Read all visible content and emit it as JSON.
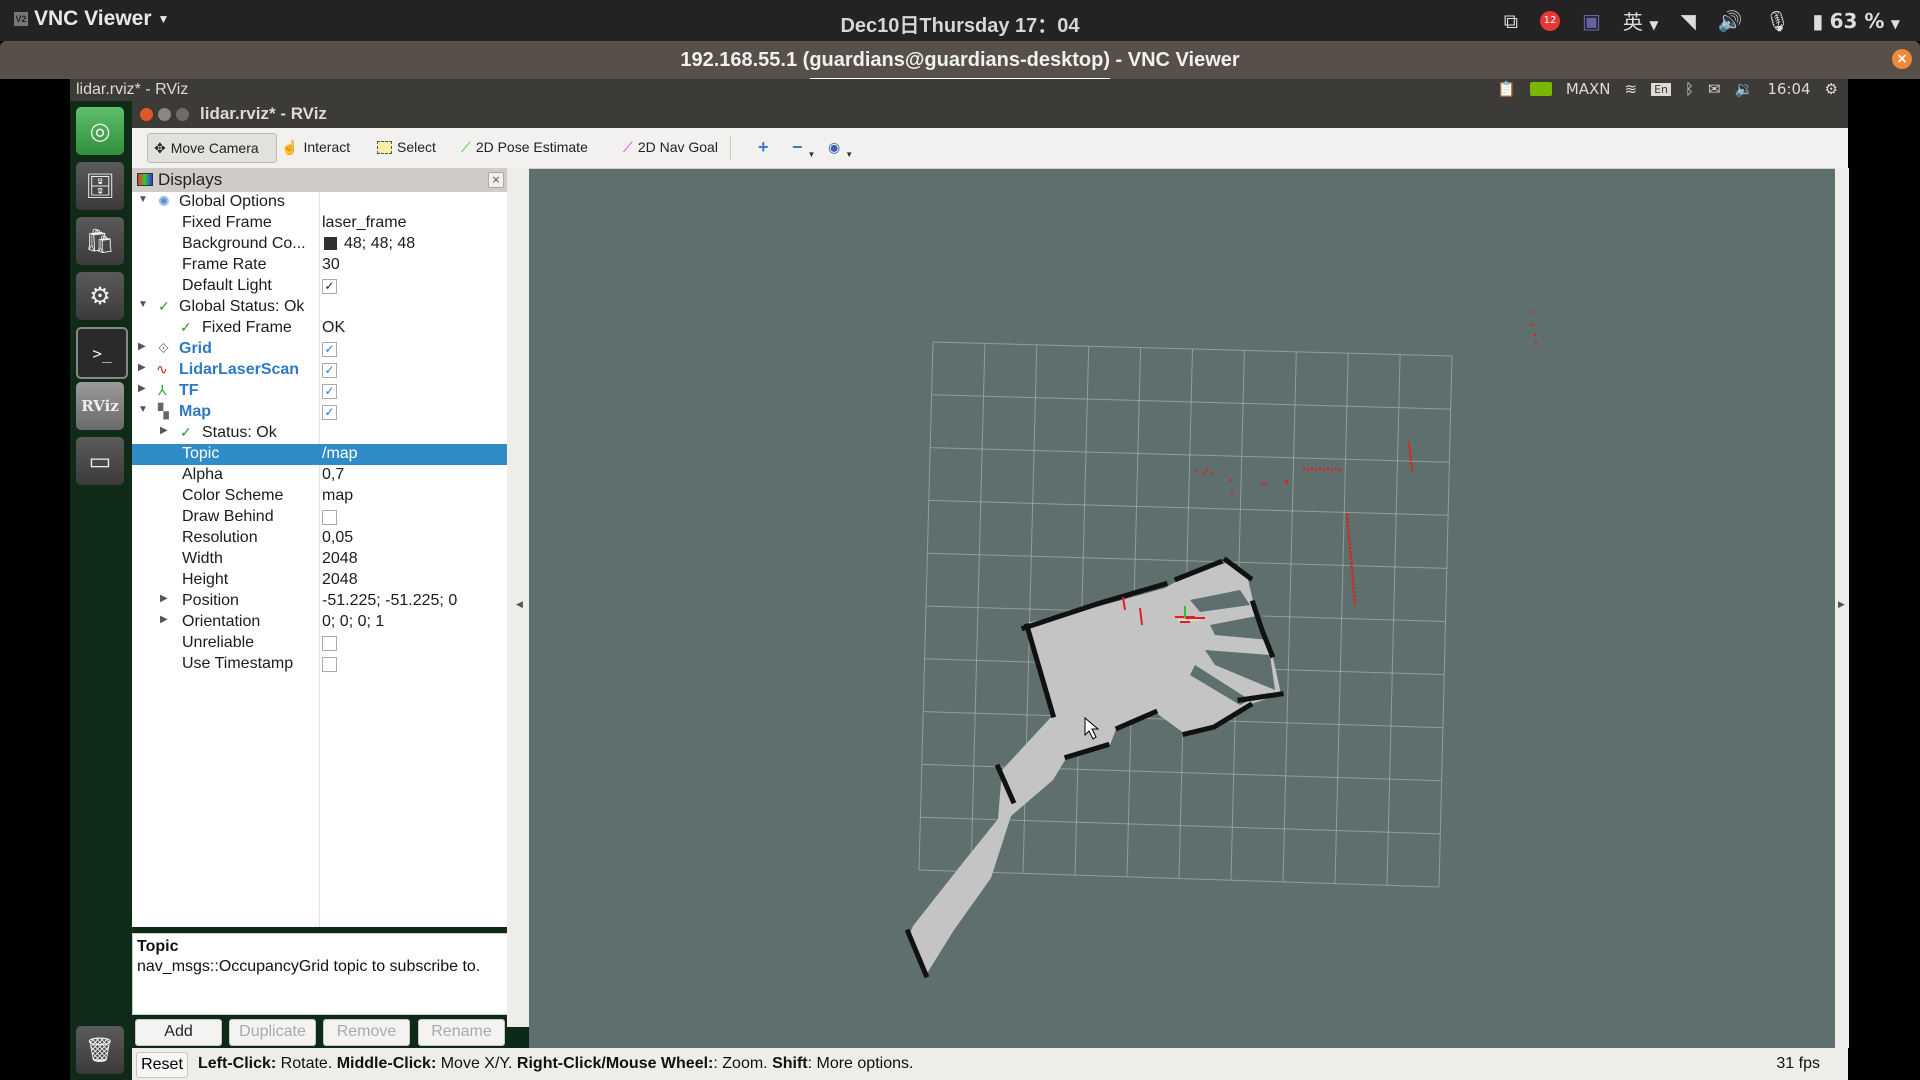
{
  "host": {
    "app_menu": "VNC Viewer",
    "clock": "Dec10日Thursday  17：04",
    "notification_count": "12",
    "input_method": "英",
    "battery": "63 %"
  },
  "vnc": {
    "window_title": "192.168.55.1 (guardians@guardians-desktop) - VNC Viewer"
  },
  "remote_panel": {
    "title": "lidar.rviz* - RViz",
    "power_mode": "MAXN",
    "keyboard": "En",
    "time": "16:04"
  },
  "launcher": {
    "items": [
      {
        "name": "ubuntu-dash",
        "glyph": "◎"
      },
      {
        "name": "files",
        "glyph": "🗄"
      },
      {
        "name": "software-center",
        "glyph": "🛍"
      },
      {
        "name": "system-settings",
        "glyph": "⚙"
      },
      {
        "name": "terminal",
        "glyph": ">_"
      },
      {
        "name": "rviz",
        "glyph": "RViz"
      },
      {
        "name": "drive",
        "glyph": "▭"
      }
    ],
    "trash_glyph": "🗑"
  },
  "rviz": {
    "title": "lidar.rviz* - RViz",
    "toolbar": {
      "move_camera": "Move Camera",
      "interact": "Interact",
      "select": "Select",
      "pose_estimate": "2D Pose Estimate",
      "nav_goal": "2D Nav Goal"
    },
    "displays": {
      "title": "Displays",
      "rows": [
        {
          "label": "Global Options",
          "value": ""
        },
        {
          "label": "Fixed Frame",
          "value": "laser_frame"
        },
        {
          "label": "Background Co...",
          "value": "48; 48; 48"
        },
        {
          "label": "Frame Rate",
          "value": "30"
        },
        {
          "label": "Default Light",
          "value": "checked"
        },
        {
          "label": "Global Status: Ok",
          "value": ""
        },
        {
          "label": "Fixed Frame",
          "value": "OK"
        },
        {
          "label": "Grid",
          "value": "checked"
        },
        {
          "label": "LidarLaserScan",
          "value": "checked"
        },
        {
          "label": "TF",
          "value": "checked"
        },
        {
          "label": "Map",
          "value": "checked"
        },
        {
          "label": "Status: Ok",
          "value": ""
        },
        {
          "label": "Topic",
          "value": "/map"
        },
        {
          "label": "Alpha",
          "value": "0,7"
        },
        {
          "label": "Color Scheme",
          "value": "map"
        },
        {
          "label": "Draw Behind",
          "value": "unchecked"
        },
        {
          "label": "Resolution",
          "value": "0,05"
        },
        {
          "label": "Width",
          "value": "2048"
        },
        {
          "label": "Height",
          "value": "2048"
        },
        {
          "label": "Position",
          "value": "-51.225; -51.225; 0"
        },
        {
          "label": "Orientation",
          "value": "0; 0; 0; 1"
        },
        {
          "label": "Unreliable",
          "value": "unchecked"
        },
        {
          "label": "Use Timestamp",
          "value": "unchecked"
        }
      ],
      "background_color": "#303030"
    },
    "help": {
      "title": "Topic",
      "text": "nav_msgs::OccupancyGrid topic to subscribe to."
    },
    "buttons": {
      "add": "Add",
      "duplicate": "Duplicate",
      "remove": "Remove",
      "rename": "Rename"
    },
    "status": {
      "reset": "Reset",
      "k1": "Left-Click:",
      "t1": " Rotate. ",
      "k2": "Middle-Click:",
      "t2": " Move X/Y. ",
      "k3": "Right-Click/Mouse Wheel:",
      "t3": ": Zoom. ",
      "k4": "Shift",
      "t4": ": More options.",
      "fps": "31 fps"
    },
    "view": {
      "background": "#5f6f6d",
      "grid_color": "#a0a8a6",
      "map_free": "#c4c4c4",
      "map_occupied": "#111111",
      "laser_color": "#e02020"
    }
  }
}
